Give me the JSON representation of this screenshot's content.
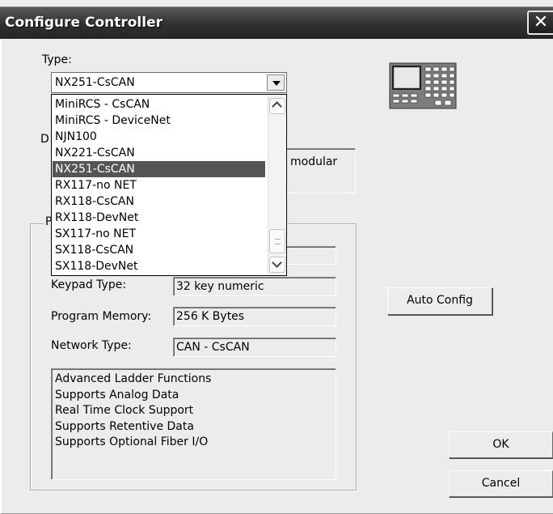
{
  "window": {
    "title": "Configure Controller",
    "close_glyph": "✕"
  },
  "type_section": {
    "label": "Type:",
    "selected_value": "NX251-CsCAN",
    "options": [
      "MiniRCS - CsCAN",
      "MiniRCS - DeviceNet",
      "NJN100",
      "NX221-CsCAN",
      "NX251-CsCAN",
      "RX117-no NET",
      "RX118-CsCAN",
      "RX118-DevNet",
      "SX117-no NET",
      "SX118-CsCAN",
      "SX118-DevNet"
    ],
    "highlighted_index": 4
  },
  "description": {
    "label_partial": "D",
    "text_partial": "modular"
  },
  "properties": {
    "label_partial": "P",
    "rows": [
      {
        "label": "Keypad Type:",
        "value": "32 key numeric"
      },
      {
        "label": "Program Memory:",
        "value": "256 K Bytes"
      },
      {
        "label": "Network Type:",
        "value": "CAN - CsCAN"
      }
    ],
    "features": [
      "Advanced Ladder Functions",
      "Supports Analog Data",
      "Real Time Clock Support",
      "Supports Retentive Data",
      "Supports Optional Fiber I/O"
    ]
  },
  "buttons": {
    "auto_config": "Auto Config",
    "ok": "OK",
    "cancel": "Cancel"
  },
  "icons": {
    "close": "close-icon",
    "controller": "controller-device-icon",
    "dropdown": "chevron-down-icon"
  }
}
